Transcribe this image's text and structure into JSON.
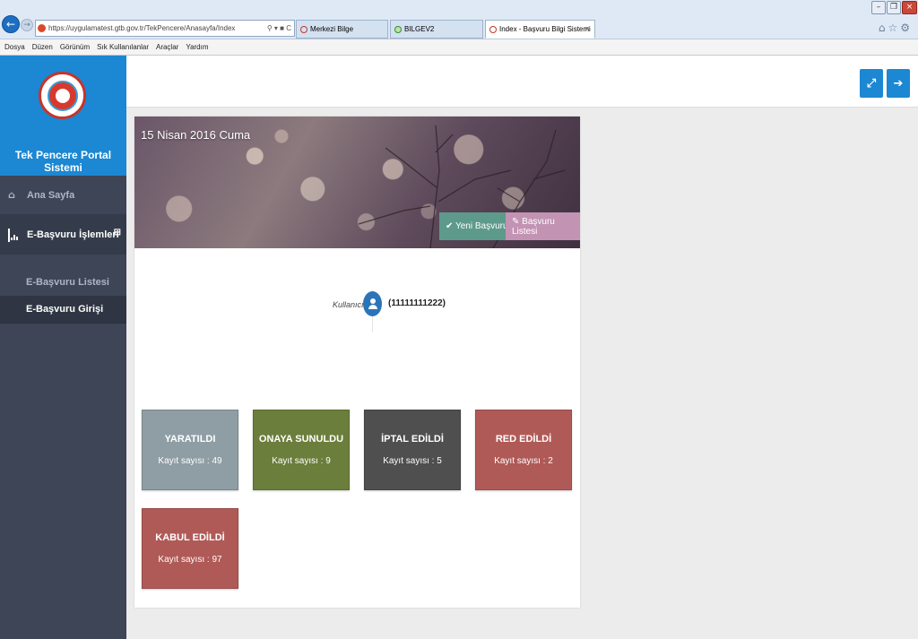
{
  "browser": {
    "url": "https://uygulamatest.gtb.gov.tr/TekPencere/Anasayfa/Index",
    "tabs": [
      {
        "label": "Merkezi Bilge"
      },
      {
        "label": "BILGEV2"
      },
      {
        "label": "Index - Başvuru Bilgi Sistemi"
      }
    ],
    "menu": [
      "Dosya",
      "Düzen",
      "Görünüm",
      "Sık Kullanılanlar",
      "Araçlar",
      "Yardım"
    ]
  },
  "sidebar": {
    "brand": "Tek Pencere Portal Sistemi",
    "items": [
      {
        "label": "Ana Sayfa",
        "icon": "home-icon"
      },
      {
        "label": "E-Başvuru İşlemleri",
        "icon": "bar-chart-icon",
        "toggle": "⊟"
      }
    ],
    "subitems": [
      {
        "label": "E-Başvuru Listesi"
      },
      {
        "label": "E-Başvuru Girişi"
      }
    ]
  },
  "header": {
    "fullscreen_icon": "fullscreen-icon",
    "logout_icon": "logout-icon"
  },
  "banner": {
    "date": "15 Nisan 2016 Cuma",
    "new_button": "✔ Yeni Başvuru",
    "list_button": "✎ Başvuru Listesi"
  },
  "user": {
    "label": "Kullanıcı",
    "id": "(11111111222)"
  },
  "stats": [
    {
      "title": "YARATILDI",
      "count": "Kayıt sayısı : 49",
      "color": "#8f9ea5"
    },
    {
      "title": "ONAYA SUNULDU",
      "count": "Kayıt sayısı : 9",
      "color": "#6c7e3b"
    },
    {
      "title": "İPTAL EDİLDİ",
      "count": "Kayıt sayısı : 5",
      "color": "#4f4f4f"
    },
    {
      "title": "RED EDİLDİ",
      "count": "Kayıt sayısı : 2",
      "color": "#b05a57"
    },
    {
      "title": "KABUL EDİLDİ",
      "count": "Kayıt sayısı : 97",
      "color": "#b05a57"
    }
  ],
  "colors": {
    "accent": "#1c87d2",
    "sidebar": "#3d4556",
    "new_button": "#5d9a8b",
    "list_button": "#c393b3"
  }
}
